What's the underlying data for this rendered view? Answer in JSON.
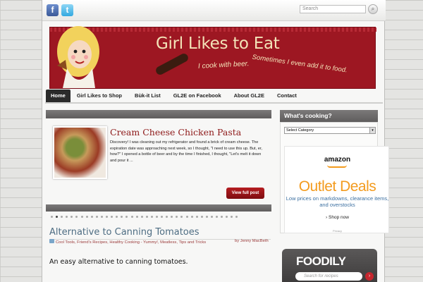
{
  "search": {
    "placeholder": "Search",
    "button_icon": "magnifier-icon"
  },
  "social": {
    "facebook": "f",
    "twitter": "t"
  },
  "banner": {
    "title": "Girl Likes to Eat",
    "tagline_1": "I cook with beer.",
    "tagline_2": "Sometimes I even add it to food."
  },
  "nav": {
    "items": [
      "Home",
      "Girl Likes to Shop",
      "Bùk-it List",
      "GL2E on Facebook",
      "About GL2E",
      "Contact"
    ]
  },
  "featured": {
    "title": "Cream Cheese Chicken Pasta",
    "body": "Discovery! I was cleaning out my refrigerator and found a brick of cream cheese. The expiration date was approaching next week, so I thought, \"I need to use this up. But, er, how?\" I opened a bottle of beer and by the time I finished, I thought, \"Let's melt it down and pour it ...",
    "button": "View full post",
    "dots_total": 38,
    "active_dot": 1
  },
  "post": {
    "title": "Alternative to Canning Tomatoes",
    "categories": "Cool Tools, Friend's Recipes, Healthy Cooking - Yummy!, Meatless, Tips and Tricks",
    "byline": "by Jenny MacBeth",
    "excerpt": "An easy alternative to canning tomatoes."
  },
  "sidebar": {
    "heading": "What's cooking?",
    "select_value": "Select Category",
    "ad": {
      "logo": "amazon",
      "headline": "Outlet Deals",
      "sub": "Low prices on markdowns, clearance items, and overstocks",
      "link": "› Shop now",
      "privacy": "Privacy"
    },
    "foodily": {
      "logo": "FOODILY",
      "placeholder": "Search for recipes",
      "go": "›"
    }
  },
  "colors": {
    "accent": "#9d1722",
    "nav_active": "#2b2b2b",
    "title_blue": "#4e6d83",
    "amazon_orange": "#f39b1e"
  }
}
